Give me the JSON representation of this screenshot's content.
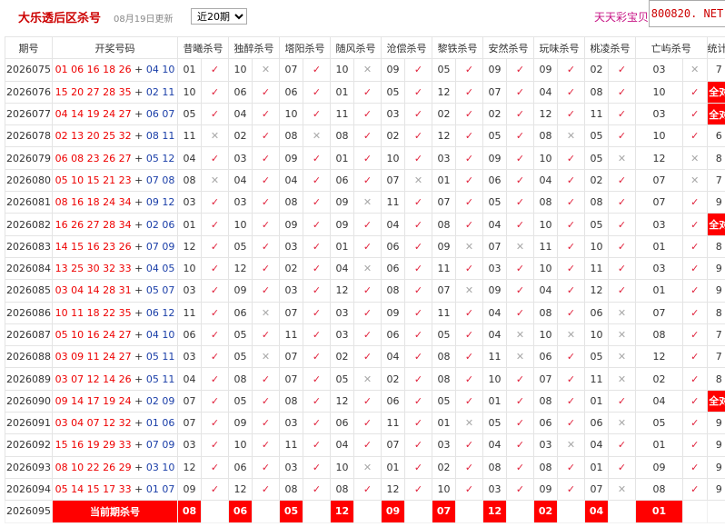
{
  "header": {
    "title": "大乐透后区杀号",
    "updated": "08月19日更新",
    "period_select": "近20期",
    "period_options": [
      "近20期"
    ],
    "ad_text": "天天彩宝贝",
    "watermark": "800820. NET"
  },
  "table": {
    "columns": [
      "期号",
      "开奖号码",
      "昔曦杀号",
      "独醉杀号",
      "塔阳杀号",
      "随风杀号",
      "沧偿杀号",
      "黎铁杀号",
      "安然杀号",
      "玩味杀号",
      "桃凌杀号",
      "亡屿杀号",
      "统计概况"
    ],
    "all_correct_label": "全对",
    "check_symbols": {
      "ok": "✓",
      "no": "✕"
    },
    "rows": [
      {
        "issue": "2026075",
        "red": "01 06 16 18 26",
        "plus": "+",
        "blue": "04 10",
        "picks": [
          [
            "01",
            "ok"
          ],
          [
            "10",
            "no"
          ],
          [
            "07",
            "ok"
          ],
          [
            "10",
            "no"
          ],
          [
            "09",
            "ok"
          ],
          [
            "05",
            "ok"
          ],
          [
            "09",
            "ok"
          ],
          [
            "09",
            "ok"
          ],
          [
            "02",
            "ok"
          ],
          [
            "03",
            "no"
          ]
        ],
        "count": "7"
      },
      {
        "issue": "2026076",
        "red": "15 20 27 28 35",
        "plus": "+",
        "blue": "02 11",
        "picks": [
          [
            "10",
            "ok"
          ],
          [
            "06",
            "ok"
          ],
          [
            "06",
            "ok"
          ],
          [
            "01",
            "ok"
          ],
          [
            "05",
            "ok"
          ],
          [
            "12",
            "ok"
          ],
          [
            "07",
            "ok"
          ],
          [
            "04",
            "ok"
          ],
          [
            "08",
            "ok"
          ],
          [
            "10",
            "ok"
          ]
        ],
        "count": "全对"
      },
      {
        "issue": "2026077",
        "red": "04 14 19 24 27",
        "plus": "+",
        "blue": "06 07",
        "picks": [
          [
            "05",
            "ok"
          ],
          [
            "04",
            "ok"
          ],
          [
            "10",
            "ok"
          ],
          [
            "11",
            "ok"
          ],
          [
            "03",
            "ok"
          ],
          [
            "02",
            "ok"
          ],
          [
            "02",
            "ok"
          ],
          [
            "12",
            "ok"
          ],
          [
            "11",
            "ok"
          ],
          [
            "03",
            "ok"
          ]
        ],
        "count": "全对"
      },
      {
        "issue": "2026078",
        "red": "02 13 20 25 32",
        "plus": "+",
        "blue": "08 11",
        "picks": [
          [
            "11",
            "no"
          ],
          [
            "02",
            "ok"
          ],
          [
            "08",
            "no"
          ],
          [
            "08",
            "ok"
          ],
          [
            "02",
            "ok"
          ],
          [
            "12",
            "ok"
          ],
          [
            "05",
            "ok"
          ],
          [
            "08",
            "no"
          ],
          [
            "05",
            "ok"
          ],
          [
            "10",
            "ok"
          ]
        ],
        "count": "6"
      },
      {
        "issue": "2026079",
        "red": "06 08 23 26 27",
        "plus": "+",
        "blue": "05 12",
        "picks": [
          [
            "04",
            "ok"
          ],
          [
            "03",
            "ok"
          ],
          [
            "09",
            "ok"
          ],
          [
            "01",
            "ok"
          ],
          [
            "10",
            "ok"
          ],
          [
            "03",
            "ok"
          ],
          [
            "09",
            "ok"
          ],
          [
            "10",
            "ok"
          ],
          [
            "05",
            "no"
          ],
          [
            "12",
            "no"
          ]
        ],
        "count": "8"
      },
      {
        "issue": "2026080",
        "red": "05 10 15 21 23",
        "plus": "+",
        "blue": "07 08",
        "picks": [
          [
            "08",
            "no"
          ],
          [
            "04",
            "ok"
          ],
          [
            "04",
            "ok"
          ],
          [
            "06",
            "ok"
          ],
          [
            "07",
            "no"
          ],
          [
            "01",
            "ok"
          ],
          [
            "06",
            "ok"
          ],
          [
            "04",
            "ok"
          ],
          [
            "02",
            "ok"
          ],
          [
            "07",
            "no"
          ]
        ],
        "count": "7"
      },
      {
        "issue": "2026081",
        "red": "08 16 18 24 34",
        "plus": "+",
        "blue": "09 12",
        "picks": [
          [
            "03",
            "ok"
          ],
          [
            "03",
            "ok"
          ],
          [
            "08",
            "ok"
          ],
          [
            "09",
            "no"
          ],
          [
            "11",
            "ok"
          ],
          [
            "07",
            "ok"
          ],
          [
            "05",
            "ok"
          ],
          [
            "08",
            "ok"
          ],
          [
            "08",
            "ok"
          ],
          [
            "07",
            "ok"
          ]
        ],
        "count": "9"
      },
      {
        "issue": "2026082",
        "red": "16 26 27 28 34",
        "plus": "+",
        "blue": "02 06",
        "picks": [
          [
            "01",
            "ok"
          ],
          [
            "10",
            "ok"
          ],
          [
            "09",
            "ok"
          ],
          [
            "09",
            "ok"
          ],
          [
            "04",
            "ok"
          ],
          [
            "08",
            "ok"
          ],
          [
            "04",
            "ok"
          ],
          [
            "10",
            "ok"
          ],
          [
            "05",
            "ok"
          ],
          [
            "03",
            "ok"
          ]
        ],
        "count": "全对"
      },
      {
        "issue": "2026083",
        "red": "14 15 16 23 26",
        "plus": "+",
        "blue": "07 09",
        "picks": [
          [
            "12",
            "ok"
          ],
          [
            "05",
            "ok"
          ],
          [
            "03",
            "ok"
          ],
          [
            "01",
            "ok"
          ],
          [
            "06",
            "ok"
          ],
          [
            "09",
            "no"
          ],
          [
            "07",
            "no"
          ],
          [
            "11",
            "ok"
          ],
          [
            "10",
            "ok"
          ],
          [
            "01",
            "ok"
          ]
        ],
        "count": "8"
      },
      {
        "issue": "2026084",
        "red": "13 25 30 32 33",
        "plus": "+",
        "blue": "04 05",
        "picks": [
          [
            "10",
            "ok"
          ],
          [
            "12",
            "ok"
          ],
          [
            "02",
            "ok"
          ],
          [
            "04",
            "no"
          ],
          [
            "06",
            "ok"
          ],
          [
            "11",
            "ok"
          ],
          [
            "03",
            "ok"
          ],
          [
            "10",
            "ok"
          ],
          [
            "11",
            "ok"
          ],
          [
            "03",
            "ok"
          ]
        ],
        "count": "9"
      },
      {
        "issue": "2026085",
        "red": "03 04 14 28 31",
        "plus": "+",
        "blue": "05 07",
        "picks": [
          [
            "03",
            "ok"
          ],
          [
            "09",
            "ok"
          ],
          [
            "03",
            "ok"
          ],
          [
            "12",
            "ok"
          ],
          [
            "08",
            "ok"
          ],
          [
            "07",
            "no"
          ],
          [
            "09",
            "ok"
          ],
          [
            "04",
            "ok"
          ],
          [
            "12",
            "ok"
          ],
          [
            "01",
            "ok"
          ]
        ],
        "count": "9"
      },
      {
        "issue": "2026086",
        "red": "10 11 18 22 35",
        "plus": "+",
        "blue": "06 12",
        "picks": [
          [
            "11",
            "ok"
          ],
          [
            "06",
            "no"
          ],
          [
            "07",
            "ok"
          ],
          [
            "03",
            "ok"
          ],
          [
            "09",
            "ok"
          ],
          [
            "11",
            "ok"
          ],
          [
            "04",
            "ok"
          ],
          [
            "08",
            "ok"
          ],
          [
            "06",
            "no"
          ],
          [
            "07",
            "ok"
          ]
        ],
        "count": "8"
      },
      {
        "issue": "2026087",
        "red": "05 10 16 24 27",
        "plus": "+",
        "blue": "04 10",
        "picks": [
          [
            "06",
            "ok"
          ],
          [
            "05",
            "ok"
          ],
          [
            "11",
            "ok"
          ],
          [
            "03",
            "ok"
          ],
          [
            "06",
            "ok"
          ],
          [
            "05",
            "ok"
          ],
          [
            "04",
            "no"
          ],
          [
            "10",
            "no"
          ],
          [
            "10",
            "no"
          ],
          [
            "08",
            "ok"
          ]
        ],
        "count": "7"
      },
      {
        "issue": "2026088",
        "red": "03 09 11 24 27",
        "plus": "+",
        "blue": "05 11",
        "picks": [
          [
            "03",
            "ok"
          ],
          [
            "05",
            "no"
          ],
          [
            "07",
            "ok"
          ],
          [
            "02",
            "ok"
          ],
          [
            "04",
            "ok"
          ],
          [
            "08",
            "ok"
          ],
          [
            "11",
            "no"
          ],
          [
            "06",
            "ok"
          ],
          [
            "05",
            "no"
          ],
          [
            "12",
            "ok"
          ]
        ],
        "count": "7"
      },
      {
        "issue": "2026089",
        "red": "03 07 12 14 26",
        "plus": "+",
        "blue": "05 11",
        "picks": [
          [
            "04",
            "ok"
          ],
          [
            "08",
            "ok"
          ],
          [
            "07",
            "ok"
          ],
          [
            "05",
            "no"
          ],
          [
            "02",
            "ok"
          ],
          [
            "08",
            "ok"
          ],
          [
            "10",
            "ok"
          ],
          [
            "07",
            "ok"
          ],
          [
            "11",
            "no"
          ],
          [
            "02",
            "ok"
          ]
        ],
        "count": "8"
      },
      {
        "issue": "2026090",
        "red": "09 14 17 19 24",
        "plus": "+",
        "blue": "02 09",
        "picks": [
          [
            "07",
            "ok"
          ],
          [
            "05",
            "ok"
          ],
          [
            "08",
            "ok"
          ],
          [
            "12",
            "ok"
          ],
          [
            "06",
            "ok"
          ],
          [
            "05",
            "ok"
          ],
          [
            "01",
            "ok"
          ],
          [
            "08",
            "ok"
          ],
          [
            "01",
            "ok"
          ],
          [
            "04",
            "ok"
          ]
        ],
        "count": "全对"
      },
      {
        "issue": "2026091",
        "red": "03 04 07 12 32",
        "plus": "+",
        "blue": "01 06",
        "picks": [
          [
            "07",
            "ok"
          ],
          [
            "09",
            "ok"
          ],
          [
            "03",
            "ok"
          ],
          [
            "06",
            "ok"
          ],
          [
            "11",
            "ok"
          ],
          [
            "01",
            "no"
          ],
          [
            "05",
            "ok"
          ],
          [
            "06",
            "ok"
          ],
          [
            "06",
            "no"
          ],
          [
            "05",
            "ok"
          ]
        ],
        "count": "9"
      },
      {
        "issue": "2026092",
        "red": "15 16 19 29 33",
        "plus": "+",
        "blue": "07 09",
        "picks": [
          [
            "03",
            "ok"
          ],
          [
            "10",
            "ok"
          ],
          [
            "11",
            "ok"
          ],
          [
            "04",
            "ok"
          ],
          [
            "07",
            "ok"
          ],
          [
            "03",
            "ok"
          ],
          [
            "04",
            "ok"
          ],
          [
            "03",
            "no"
          ],
          [
            "04",
            "ok"
          ],
          [
            "01",
            "ok"
          ]
        ],
        "count": "9"
      },
      {
        "issue": "2026093",
        "red": "08 10 22 26 29",
        "plus": "+",
        "blue": "03 10",
        "picks": [
          [
            "12",
            "ok"
          ],
          [
            "06",
            "ok"
          ],
          [
            "03",
            "ok"
          ],
          [
            "10",
            "no"
          ],
          [
            "01",
            "ok"
          ],
          [
            "02",
            "ok"
          ],
          [
            "08",
            "ok"
          ],
          [
            "08",
            "ok"
          ],
          [
            "01",
            "ok"
          ],
          [
            "09",
            "ok"
          ]
        ],
        "count": "9"
      },
      {
        "issue": "2026094",
        "red": "05 14 15 17 33",
        "plus": "+",
        "blue": "01 07",
        "picks": [
          [
            "09",
            "ok"
          ],
          [
            "12",
            "ok"
          ],
          [
            "08",
            "ok"
          ],
          [
            "08",
            "ok"
          ],
          [
            "12",
            "ok"
          ],
          [
            "10",
            "ok"
          ],
          [
            "03",
            "ok"
          ],
          [
            "09",
            "ok"
          ],
          [
            "07",
            "no"
          ],
          [
            "08",
            "ok"
          ]
        ],
        "count": "9"
      }
    ],
    "current": {
      "issue": "2026095",
      "label": "当前期杀号",
      "picks": [
        "08",
        "06",
        "05",
        "12",
        "09",
        "07",
        "12",
        "02",
        "04",
        "01"
      ]
    }
  }
}
